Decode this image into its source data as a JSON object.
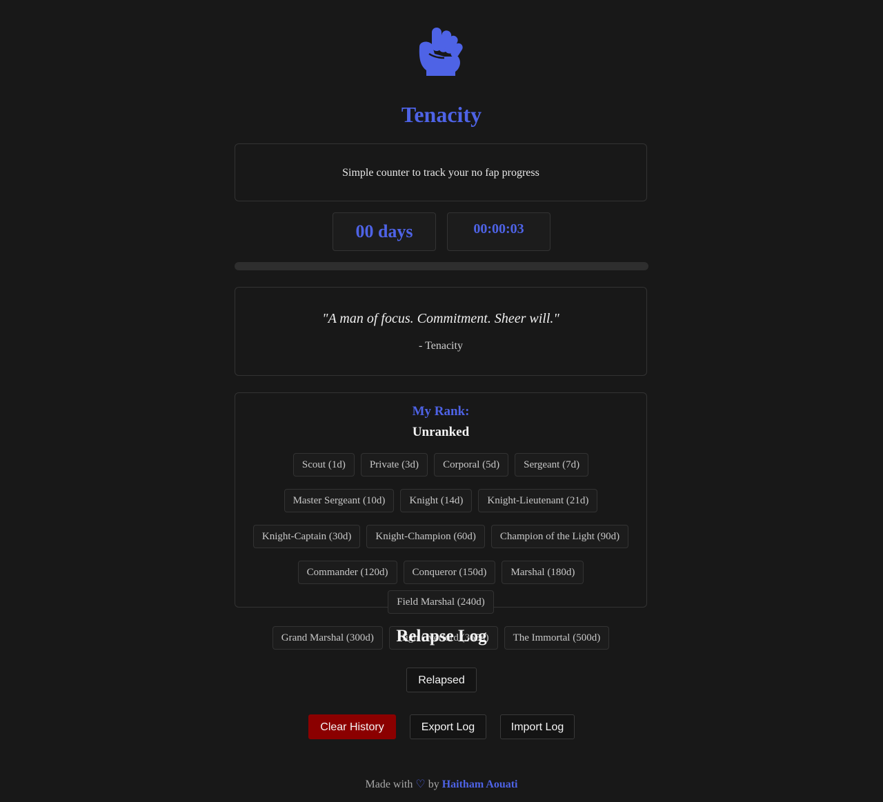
{
  "app": {
    "title": "Tenacity",
    "logo_icon": "raised-fist-icon",
    "accent_color": "#4e63e6"
  },
  "description": "Simple counter to track your no fap progress",
  "counter": {
    "days": "00 days",
    "time": "00:00:03",
    "progress_fraction": 0
  },
  "quote": {
    "text": "\"A man of focus. Commitment. Sheer will.\"",
    "author": "- Tenacity"
  },
  "rank": {
    "label": "My Rank:",
    "current": "Unranked",
    "tiers": [
      "Scout (1d)",
      "Private (3d)",
      "Corporal (5d)",
      "Sergeant (7d)",
      "Master Sergeant (10d)",
      "Knight (14d)",
      "Knight-Lieutenant (21d)",
      "Knight-Captain (30d)",
      "Knight-Champion (60d)",
      "Champion of the Light (90d)",
      "Commander (120d)",
      "Conqueror (150d)",
      "Marshal (180d)",
      "Field Marshal (240d)",
      "Grand Marshal (300d)",
      "High Overlord (365d)",
      "The Immortal (500d)"
    ]
  },
  "relapse_log": {
    "title": "Relapse Log",
    "relapsed_label": "Relapsed",
    "clear_label": "Clear History",
    "export_label": "Export Log",
    "import_label": "Import Log",
    "clear_color": "#8b0000"
  },
  "footer": {
    "prefix": "Made with",
    "heart": "♡",
    "by": "by",
    "author": "Haitham Aouati"
  }
}
